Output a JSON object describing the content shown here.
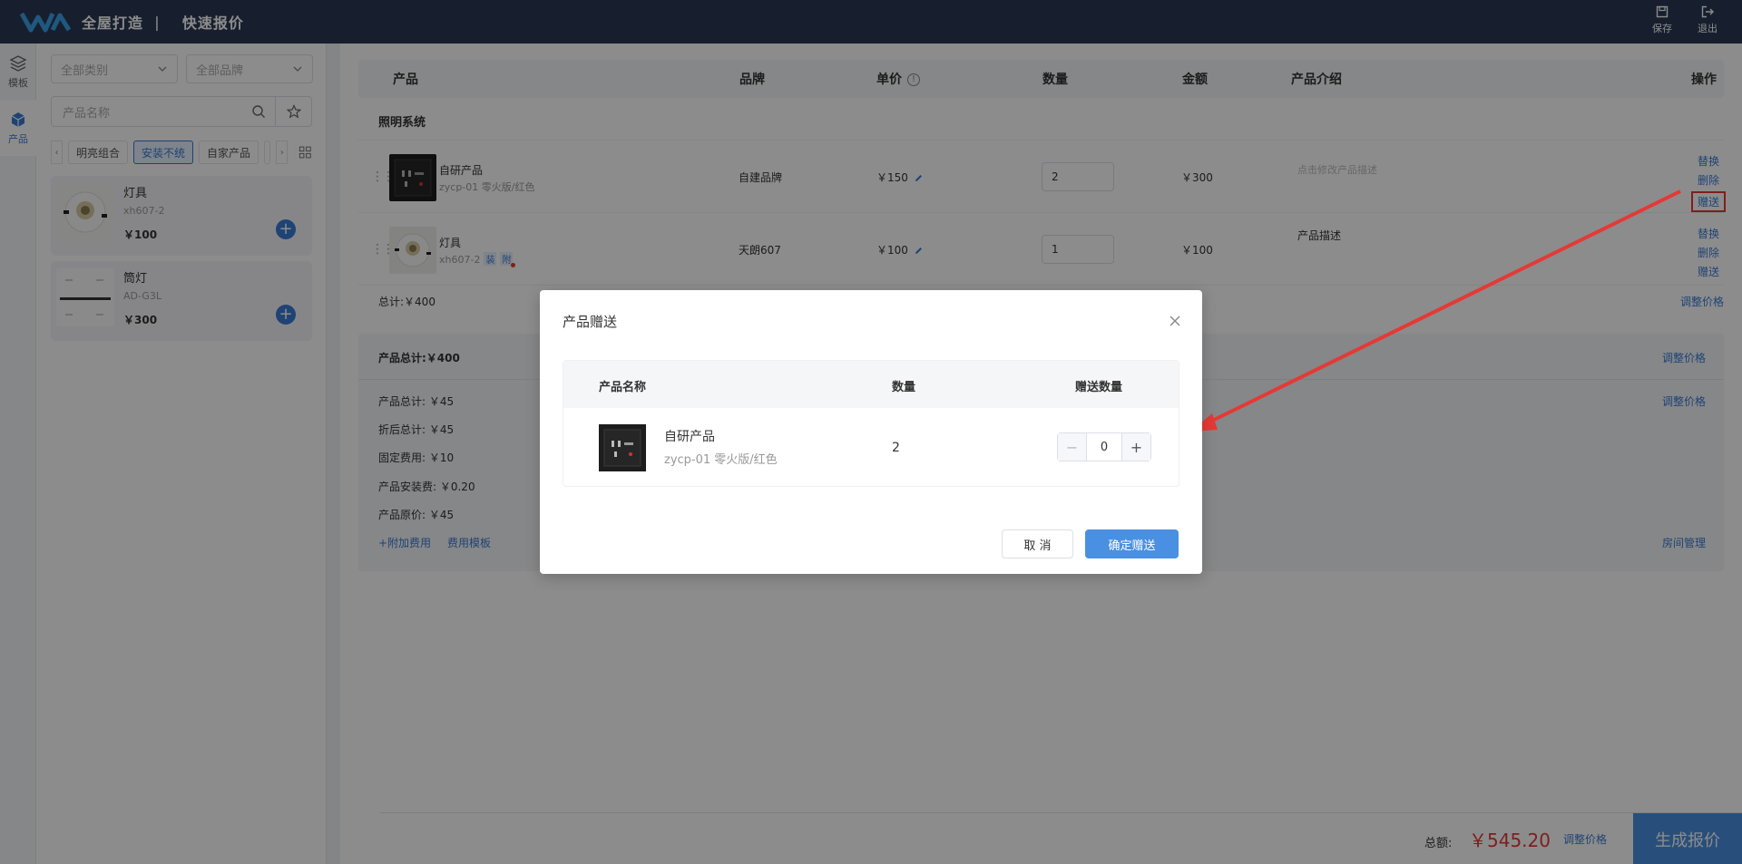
{
  "header": {
    "app_name": "全屋打造",
    "separator": "|",
    "page_name": "快速报价",
    "save_label": "保存",
    "exit_label": "退出"
  },
  "rail": {
    "items": [
      {
        "label": "模板",
        "icon": "layers-icon"
      },
      {
        "label": "产品",
        "icon": "cube-icon"
      }
    ]
  },
  "panel": {
    "category_placeholder": "全部类别",
    "brand_placeholder": "全部品牌",
    "search_placeholder": "产品名称",
    "tabs": [
      "明亮组合",
      "安装不统",
      "自家产品"
    ],
    "active_tab": "安装不统",
    "products": [
      {
        "name": "灯具",
        "code": "xh607-2",
        "price": "￥100"
      },
      {
        "name": "筒灯",
        "code": "AD-G3L",
        "price": "￥300"
      }
    ]
  },
  "table": {
    "headers": {
      "product": "产品",
      "brand": "品牌",
      "unit_price": "单价",
      "quantity": "数量",
      "amount": "金额",
      "intro": "产品介绍",
      "actions": "操作"
    },
    "group_title": "照明系统",
    "rows": [
      {
        "name": "自研产品",
        "spec": "zycp-01 零火版/红色",
        "brand": "自建品牌",
        "price": "￥150",
        "qty": "2",
        "amount": "￥300",
        "intro": "点击修改产品描述",
        "actions": [
          "替换",
          "删除",
          "赠送"
        ]
      },
      {
        "name": "灯具",
        "spec": "xh607-2",
        "badge1": "装",
        "badge2": "附",
        "brand": "天朗607",
        "price": "￥100",
        "qty": "1",
        "amount": "￥100",
        "intro": "产品描述",
        "actions": [
          "替换",
          "删除",
          "赠送"
        ]
      }
    ],
    "subtotal": "总计:￥400",
    "adjust_price": "调整价格"
  },
  "summary": {
    "title": "产品总计:￥400",
    "lines": [
      "产品总计: ￥45",
      "折后总计: ￥45",
      "固定费用: ￥10",
      "产品安装费: ￥0.20",
      "产品原价: ￥45"
    ],
    "add_fee": "+附加费用",
    "fee_template": "费用模板",
    "adjust_price_1": "调整价格",
    "adjust_price_2": "调整价格",
    "room_manage": "房间管理"
  },
  "footer": {
    "total_label": "总额:",
    "total_value": "￥545.20",
    "adjust_price": "调整价格",
    "generate": "生成报价"
  },
  "dialog": {
    "title": "产品赠送",
    "headers": {
      "name": "产品名称",
      "qty": "数量",
      "gift_qty": "赠送数量"
    },
    "item": {
      "name": "自研产品",
      "spec": "zycp-01 零火版/红色",
      "qty": "2",
      "gift_qty": "0"
    },
    "cancel": "取 消",
    "confirm": "确定赠送"
  },
  "colors": {
    "topbar": "#2b3a55",
    "accent": "#4a90e2",
    "link": "#3a7bd5",
    "highlight": "#e53935"
  }
}
